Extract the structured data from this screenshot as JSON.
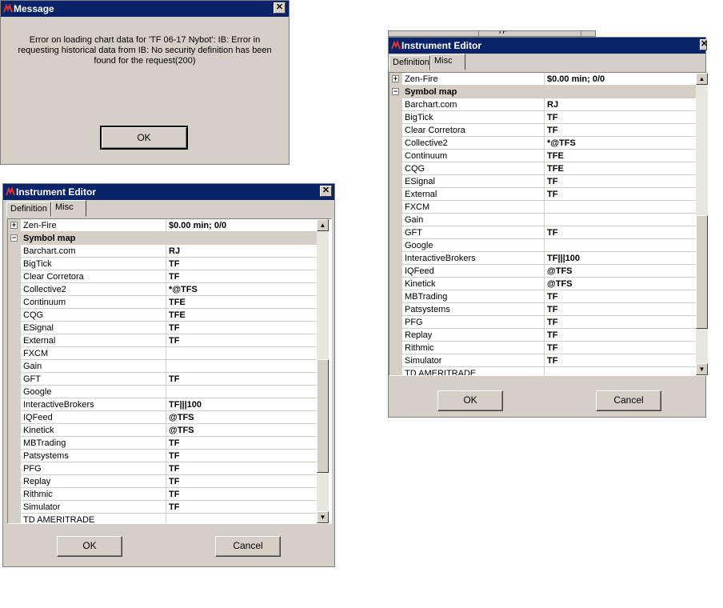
{
  "message_dialog": {
    "title": "Message",
    "text": "Error on loading chart data for 'TF 06-17 Nybot': IB: Error in requesting historical data from IB: No security definition has been found for the request(200)",
    "ok_label": "OK"
  },
  "editor_left": {
    "title": "Instrument Editor",
    "tabs": [
      "Definition",
      "Misc"
    ],
    "active_tab": "Misc",
    "zenfire": {
      "name": "Zen-Fire",
      "value": "$0.00 min;  0/0"
    },
    "section_title": "Symbol map",
    "rows": [
      {
        "name": "Barchart.com",
        "value": "RJ"
      },
      {
        "name": "BigTick",
        "value": "TF"
      },
      {
        "name": "Clear Corretora",
        "value": "TF"
      },
      {
        "name": "Collective2",
        "value": "*@TFS"
      },
      {
        "name": "Continuum",
        "value": "TFE"
      },
      {
        "name": "CQG",
        "value": "TFE"
      },
      {
        "name": "ESignal",
        "value": "TF"
      },
      {
        "name": "External",
        "value": "TF"
      },
      {
        "name": "FXCM",
        "value": ""
      },
      {
        "name": "Gain",
        "value": ""
      },
      {
        "name": "GFT",
        "value": "TF"
      },
      {
        "name": "Google",
        "value": ""
      },
      {
        "name": "InteractiveBrokers",
        "value": "TF|||100"
      },
      {
        "name": "IQFeed",
        "value": "@TFS"
      },
      {
        "name": "Kinetick",
        "value": "@TFS"
      },
      {
        "name": "MBTrading",
        "value": "TF"
      },
      {
        "name": "Patsystems",
        "value": "TF"
      },
      {
        "name": "PFG",
        "value": "TF"
      },
      {
        "name": "Replay",
        "value": "TF"
      },
      {
        "name": "Rithmic",
        "value": "TF"
      },
      {
        "name": "Simulator",
        "value": "TF"
      },
      {
        "name": "TD AMERITRADE",
        "value": ""
      }
    ],
    "ok_label": "OK",
    "cancel_label": "Cancel"
  },
  "editor_right": {
    "title": "Instrument Editor",
    "tabs": [
      "Definition",
      "Misc"
    ],
    "active_tab": "Misc",
    "background_fragment": "TF",
    "zenfire": {
      "name": "Zen-Fire",
      "value": "$0.00 min;  0/0"
    },
    "section_title": "Symbol map",
    "rows": [
      {
        "name": "Barchart.com",
        "value": "RJ"
      },
      {
        "name": "BigTick",
        "value": "TF"
      },
      {
        "name": "Clear Corretora",
        "value": "TF"
      },
      {
        "name": "Collective2",
        "value": "*@TFS"
      },
      {
        "name": "Continuum",
        "value": "TFE"
      },
      {
        "name": "CQG",
        "value": "TFE"
      },
      {
        "name": "ESignal",
        "value": "TF"
      },
      {
        "name": "External",
        "value": "TF"
      },
      {
        "name": "FXCM",
        "value": ""
      },
      {
        "name": "Gain",
        "value": ""
      },
      {
        "name": "GFT",
        "value": "TF"
      },
      {
        "name": "Google",
        "value": ""
      },
      {
        "name": "InteractiveBrokers",
        "value": "TF|||100"
      },
      {
        "name": "IQFeed",
        "value": "@TFS"
      },
      {
        "name": "Kinetick",
        "value": "@TFS"
      },
      {
        "name": "MBTrading",
        "value": "TF"
      },
      {
        "name": "Patsystems",
        "value": "TF"
      },
      {
        "name": "PFG",
        "value": "TF"
      },
      {
        "name": "Replay",
        "value": "TF"
      },
      {
        "name": "Rithmic",
        "value": "TF"
      },
      {
        "name": "Simulator",
        "value": "TF"
      },
      {
        "name": "TD AMERITRADE",
        "value": ""
      }
    ],
    "ok_label": "OK",
    "cancel_label": "Cancel"
  }
}
